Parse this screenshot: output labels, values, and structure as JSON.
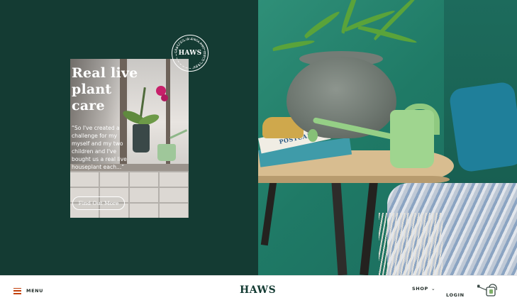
{
  "promo": {
    "stamp_text": "HAWS",
    "stamp_ring_text": "CRAFTED IN ENGLAND SINCE 1886",
    "title_lines": [
      "Real live",
      "plant",
      "care"
    ],
    "quote": "“So I've created a challenge for my myself and my two children and I've bought us a real live houseplant each...”",
    "button_label": "Find Out More"
  },
  "photo": {
    "book_text": "POSTCARDS"
  },
  "navbar": {
    "menu_label": "MENU",
    "logo": "HAWS",
    "shop_label": "SHOP",
    "login_label": "LOGIN",
    "cart_icon": "watering-can-cart-icon"
  },
  "colors": {
    "brand_dark": "#143b33",
    "accent": "#c2410c",
    "card_text": "#ffffff"
  }
}
